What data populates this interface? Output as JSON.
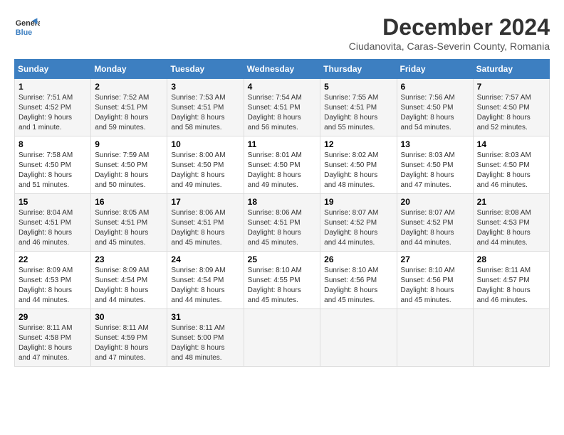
{
  "header": {
    "logo_line1": "General",
    "logo_line2": "Blue",
    "title": "December 2024",
    "subtitle": "Ciudanovita, Caras-Severin County, Romania"
  },
  "columns": [
    "Sunday",
    "Monday",
    "Tuesday",
    "Wednesday",
    "Thursday",
    "Friday",
    "Saturday"
  ],
  "weeks": [
    [
      {
        "day": "1",
        "info": "Sunrise: 7:51 AM\nSunset: 4:52 PM\nDaylight: 9 hours\nand 1 minute."
      },
      {
        "day": "2",
        "info": "Sunrise: 7:52 AM\nSunset: 4:51 PM\nDaylight: 8 hours\nand 59 minutes."
      },
      {
        "day": "3",
        "info": "Sunrise: 7:53 AM\nSunset: 4:51 PM\nDaylight: 8 hours\nand 58 minutes."
      },
      {
        "day": "4",
        "info": "Sunrise: 7:54 AM\nSunset: 4:51 PM\nDaylight: 8 hours\nand 56 minutes."
      },
      {
        "day": "5",
        "info": "Sunrise: 7:55 AM\nSunset: 4:51 PM\nDaylight: 8 hours\nand 55 minutes."
      },
      {
        "day": "6",
        "info": "Sunrise: 7:56 AM\nSunset: 4:50 PM\nDaylight: 8 hours\nand 54 minutes."
      },
      {
        "day": "7",
        "info": "Sunrise: 7:57 AM\nSunset: 4:50 PM\nDaylight: 8 hours\nand 52 minutes."
      }
    ],
    [
      {
        "day": "8",
        "info": "Sunrise: 7:58 AM\nSunset: 4:50 PM\nDaylight: 8 hours\nand 51 minutes."
      },
      {
        "day": "9",
        "info": "Sunrise: 7:59 AM\nSunset: 4:50 PM\nDaylight: 8 hours\nand 50 minutes."
      },
      {
        "day": "10",
        "info": "Sunrise: 8:00 AM\nSunset: 4:50 PM\nDaylight: 8 hours\nand 49 minutes."
      },
      {
        "day": "11",
        "info": "Sunrise: 8:01 AM\nSunset: 4:50 PM\nDaylight: 8 hours\nand 49 minutes."
      },
      {
        "day": "12",
        "info": "Sunrise: 8:02 AM\nSunset: 4:50 PM\nDaylight: 8 hours\nand 48 minutes."
      },
      {
        "day": "13",
        "info": "Sunrise: 8:03 AM\nSunset: 4:50 PM\nDaylight: 8 hours\nand 47 minutes."
      },
      {
        "day": "14",
        "info": "Sunrise: 8:03 AM\nSunset: 4:50 PM\nDaylight: 8 hours\nand 46 minutes."
      }
    ],
    [
      {
        "day": "15",
        "info": "Sunrise: 8:04 AM\nSunset: 4:51 PM\nDaylight: 8 hours\nand 46 minutes."
      },
      {
        "day": "16",
        "info": "Sunrise: 8:05 AM\nSunset: 4:51 PM\nDaylight: 8 hours\nand 45 minutes."
      },
      {
        "day": "17",
        "info": "Sunrise: 8:06 AM\nSunset: 4:51 PM\nDaylight: 8 hours\nand 45 minutes."
      },
      {
        "day": "18",
        "info": "Sunrise: 8:06 AM\nSunset: 4:51 PM\nDaylight: 8 hours\nand 45 minutes."
      },
      {
        "day": "19",
        "info": "Sunrise: 8:07 AM\nSunset: 4:52 PM\nDaylight: 8 hours\nand 44 minutes."
      },
      {
        "day": "20",
        "info": "Sunrise: 8:07 AM\nSunset: 4:52 PM\nDaylight: 8 hours\nand 44 minutes."
      },
      {
        "day": "21",
        "info": "Sunrise: 8:08 AM\nSunset: 4:53 PM\nDaylight: 8 hours\nand 44 minutes."
      }
    ],
    [
      {
        "day": "22",
        "info": "Sunrise: 8:09 AM\nSunset: 4:53 PM\nDaylight: 8 hours\nand 44 minutes."
      },
      {
        "day": "23",
        "info": "Sunrise: 8:09 AM\nSunset: 4:54 PM\nDaylight: 8 hours\nand 44 minutes."
      },
      {
        "day": "24",
        "info": "Sunrise: 8:09 AM\nSunset: 4:54 PM\nDaylight: 8 hours\nand 44 minutes."
      },
      {
        "day": "25",
        "info": "Sunrise: 8:10 AM\nSunset: 4:55 PM\nDaylight: 8 hours\nand 45 minutes."
      },
      {
        "day": "26",
        "info": "Sunrise: 8:10 AM\nSunset: 4:56 PM\nDaylight: 8 hours\nand 45 minutes."
      },
      {
        "day": "27",
        "info": "Sunrise: 8:10 AM\nSunset: 4:56 PM\nDaylight: 8 hours\nand 45 minutes."
      },
      {
        "day": "28",
        "info": "Sunrise: 8:11 AM\nSunset: 4:57 PM\nDaylight: 8 hours\nand 46 minutes."
      }
    ],
    [
      {
        "day": "29",
        "info": "Sunrise: 8:11 AM\nSunset: 4:58 PM\nDaylight: 8 hours\nand 47 minutes."
      },
      {
        "day": "30",
        "info": "Sunrise: 8:11 AM\nSunset: 4:59 PM\nDaylight: 8 hours\nand 47 minutes."
      },
      {
        "day": "31",
        "info": "Sunrise: 8:11 AM\nSunset: 5:00 PM\nDaylight: 8 hours\nand 48 minutes."
      },
      {
        "day": "",
        "info": ""
      },
      {
        "day": "",
        "info": ""
      },
      {
        "day": "",
        "info": ""
      },
      {
        "day": "",
        "info": ""
      }
    ]
  ]
}
